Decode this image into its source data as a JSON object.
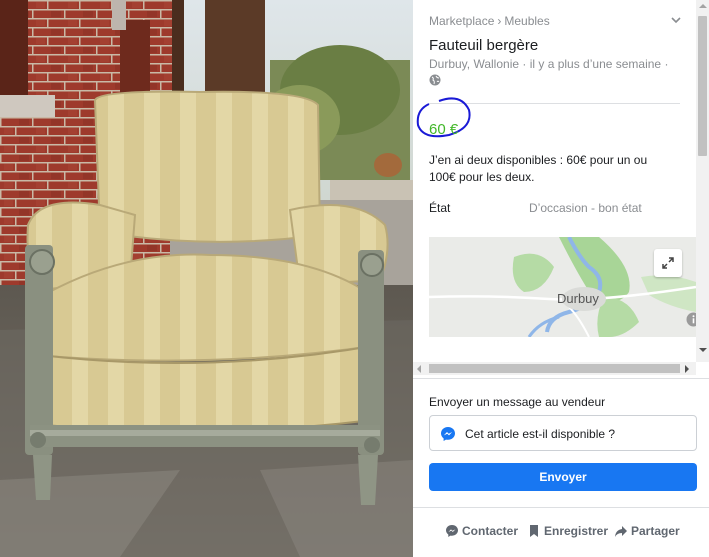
{
  "breadcrumb": {
    "root": "Marketplace",
    "separator": "›",
    "category": "Meubles"
  },
  "listing": {
    "title": "Fauteuil bergère",
    "location": "Durbuy, Wallonie · il y a plus d’une semaine ·",
    "price": "60 €",
    "description": "J’en ai deux disponibles : 60€ pour un ou 100€ pour les deux.",
    "condition_label": "État",
    "condition_value": "D’occasion - bon état"
  },
  "map": {
    "place": "Durbuy"
  },
  "message": {
    "title": "Envoyer un message au vendeur",
    "text": "Cet article est-il disponible ?",
    "send_label": "Envoyer"
  },
  "actions": {
    "contact": "Contacter",
    "save": "Enregistrer",
    "share": "Partager"
  },
  "icons": [
    "chevron-down-icon",
    "globe-icon",
    "expand-icon",
    "info-icon",
    "messenger-icon",
    "chat-bubble-icon",
    "bookmark-icon",
    "share-arrow-icon"
  ],
  "colors": {
    "price": "#42b72a",
    "send_button": "#1877f2",
    "annotation_circle": "#1a1ad6",
    "muted": "#8a8d91"
  }
}
